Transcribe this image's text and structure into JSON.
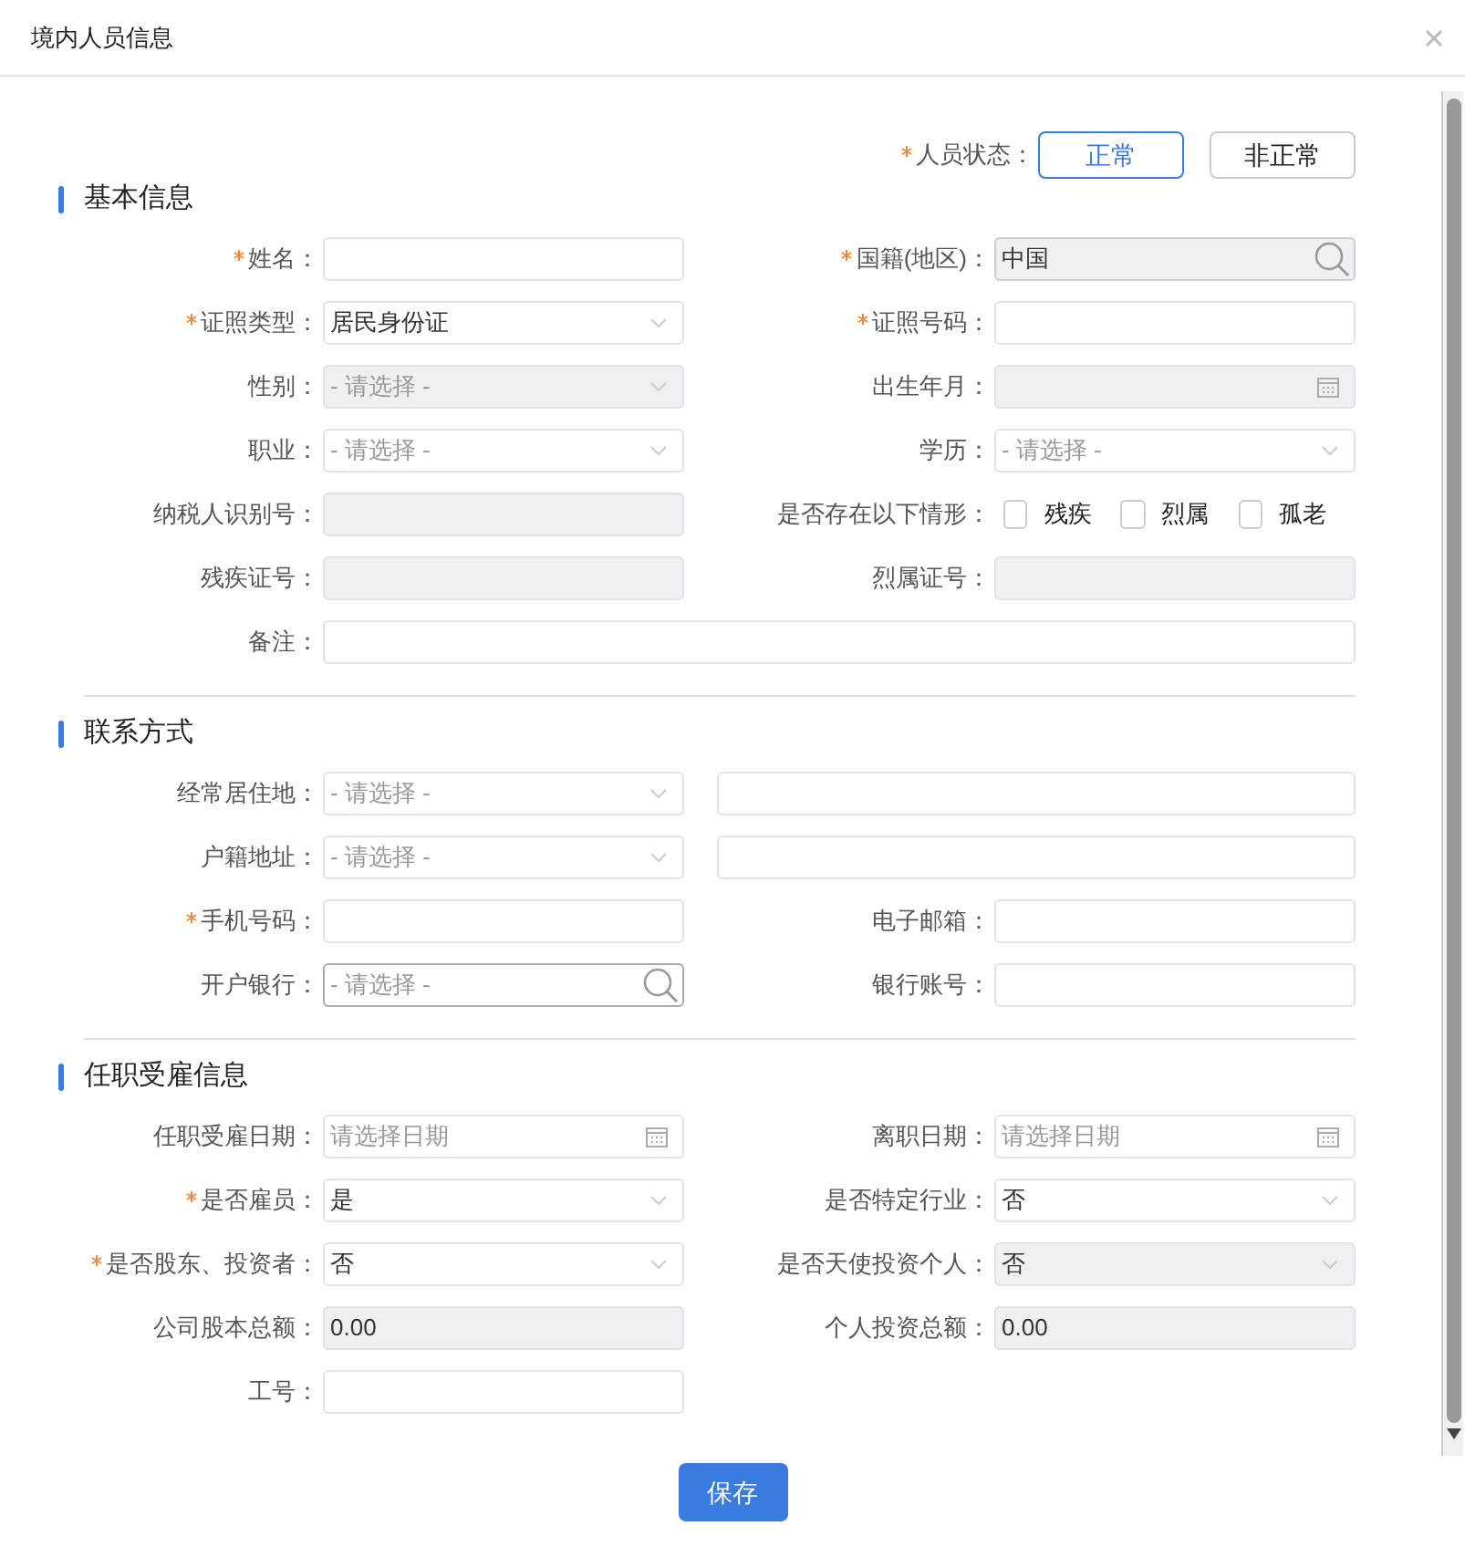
{
  "dialog": {
    "title": "境内人员信息"
  },
  "person_status": {
    "label": "人员状态：",
    "required": true,
    "options": [
      {
        "label": "正常",
        "selected": true
      },
      {
        "label": "非正常",
        "selected": false
      }
    ]
  },
  "sections": [
    {
      "title": "基本信息",
      "rows": [
        [
          {
            "label": "姓名：",
            "required": true,
            "kind": "text"
          },
          {
            "label": "国籍(地区)：",
            "required": true,
            "kind": "search",
            "value": "中国",
            "disabled": true
          }
        ],
        [
          {
            "label": "证照类型：",
            "required": true,
            "kind": "select",
            "value": "居民身份证"
          },
          {
            "label": "证照号码：",
            "required": true,
            "kind": "text"
          }
        ],
        [
          {
            "label": "性别：",
            "required": false,
            "kind": "select",
            "placeholder": "- 请选择 -",
            "disabled": true
          },
          {
            "label": "出生年月：",
            "required": false,
            "kind": "date",
            "disabled": true
          }
        ],
        [
          {
            "label": "职业：",
            "required": false,
            "kind": "select",
            "placeholder": "- 请选择 -"
          },
          {
            "label": "学历：",
            "required": false,
            "kind": "select",
            "placeholder": "- 请选择 -"
          }
        ],
        [
          {
            "label": "纳税人识别号：",
            "required": false,
            "kind": "text",
            "disabled": true
          },
          {
            "label": "是否存在以下情形：",
            "required": false,
            "kind": "checks",
            "options": [
              {
                "label": "残疾",
                "checked": false
              },
              {
                "label": "烈属",
                "checked": false
              },
              {
                "label": "孤老",
                "checked": false
              }
            ]
          }
        ],
        [
          {
            "label": "残疾证号：",
            "required": false,
            "kind": "text",
            "disabled": true
          },
          {
            "label": "烈属证号：",
            "required": false,
            "kind": "text",
            "disabled": true
          }
        ],
        [
          {
            "label": "备注：",
            "required": false,
            "kind": "long_text"
          }
        ]
      ]
    },
    {
      "title": "联系方式",
      "rows": [
        [
          {
            "label": "经常居住地：",
            "required": false,
            "kind": "address",
            "placeholder": "- 请选择 -"
          }
        ],
        [
          {
            "label": "户籍地址：",
            "required": false,
            "kind": "address",
            "placeholder": "- 请选择 -"
          }
        ],
        [
          {
            "label": "手机号码：",
            "required": true,
            "kind": "text"
          },
          {
            "label": "电子邮箱：",
            "required": false,
            "kind": "text"
          }
        ],
        [
          {
            "label": "开户银行：",
            "required": false,
            "kind": "search",
            "placeholder": "- 请选择 -"
          },
          {
            "label": "银行账号：",
            "required": false,
            "kind": "text"
          }
        ]
      ]
    },
    {
      "title": "任职受雇信息",
      "rows": [
        [
          {
            "label": "任职受雇日期：",
            "required": false,
            "kind": "date",
            "placeholder": "请选择日期"
          },
          {
            "label": "离职日期：",
            "required": false,
            "kind": "date",
            "placeholder": "请选择日期"
          }
        ],
        [
          {
            "label": "是否雇员：",
            "required": true,
            "kind": "select",
            "value": "是"
          },
          {
            "label": "是否特定行业：",
            "required": false,
            "kind": "select",
            "value": "否"
          }
        ],
        [
          {
            "label": "是否股东、投资者：",
            "required": true,
            "kind": "select",
            "value": "否"
          },
          {
            "label": "是否天使投资个人：",
            "required": false,
            "kind": "select",
            "value": "否",
            "disabled": true
          }
        ],
        [
          {
            "label": "公司股本总额：",
            "required": false,
            "kind": "text",
            "value": "0.00",
            "disabled": true
          },
          {
            "label": "个人投资总额：",
            "required": false,
            "kind": "text",
            "value": "0.00",
            "disabled": true
          }
        ],
        [
          {
            "label": "工号：",
            "required": false,
            "kind": "text"
          }
        ]
      ]
    }
  ],
  "save_button": "保存"
}
